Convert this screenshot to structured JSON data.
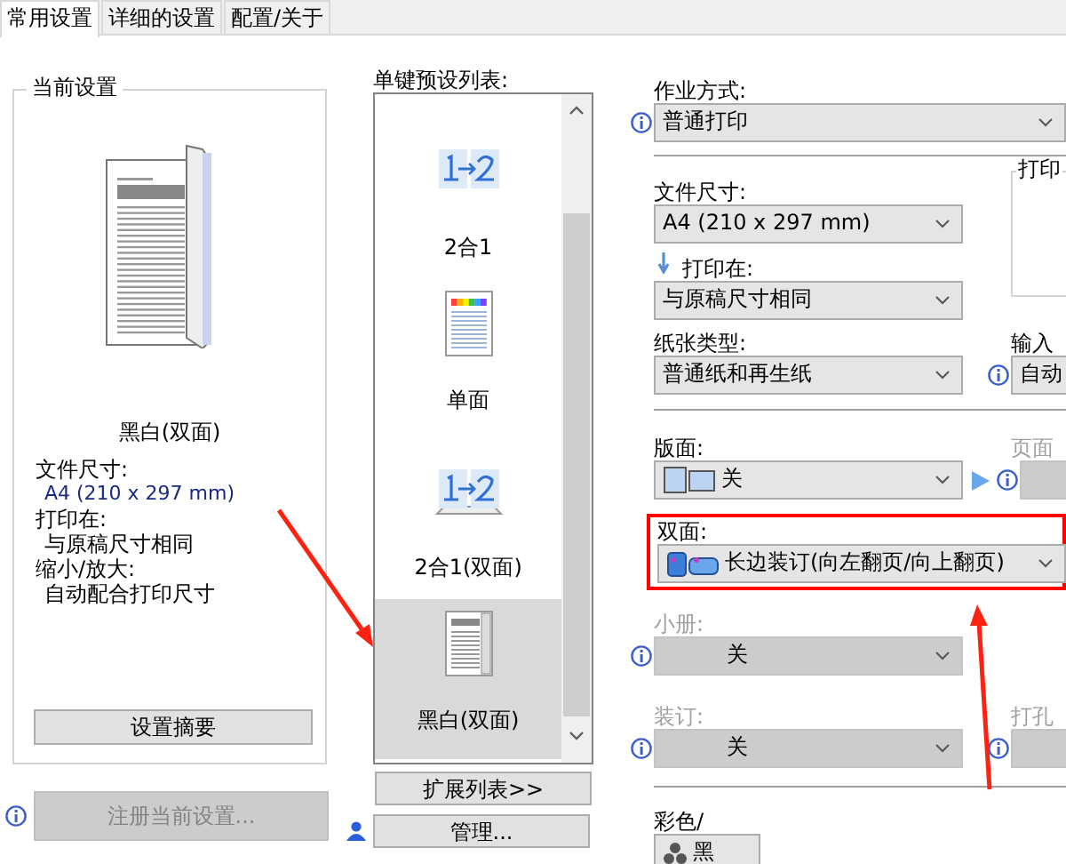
{
  "tabs": [
    {
      "label": "常用设置",
      "selected": true
    },
    {
      "label": "详细的设置",
      "selected": false
    },
    {
      "label": "配置/关于",
      "selected": false
    }
  ],
  "current_settings": {
    "title": "当前设置",
    "mode": "黑白(双面)",
    "details": [
      {
        "label": "文件尺寸:",
        "value": "A4 (210 x 297 mm)"
      },
      {
        "label": "打印在:",
        "value": "与原稿尺寸相同"
      },
      {
        "label": "缩小/放大:",
        "value": "自动配合打印尺寸"
      }
    ],
    "summary_button": "设置摘要"
  },
  "register_button": {
    "label": "注册当前设置...",
    "disabled": true
  },
  "presets": {
    "label": "单键预设列表:",
    "items": [
      {
        "label": "2合1",
        "kind": "nup",
        "selected": false
      },
      {
        "label": "单面",
        "kind": "color",
        "selected": false
      },
      {
        "label": "2合1(双面)",
        "kind": "nup-duplex",
        "selected": false
      },
      {
        "label": "黑白(双面)",
        "kind": "mono-duplex",
        "selected": true
      }
    ],
    "expand_button": "扩展列表>>",
    "manage_button": "管理..."
  },
  "job_mode": {
    "label": "作业方式:",
    "value": "普通打印",
    "disabled": false
  },
  "document_size": {
    "label": "文件尺寸:",
    "value": "A4 (210 x 297 mm)",
    "disabled": false
  },
  "print_on": {
    "label": "打印在:",
    "value": "与原稿尺寸相同",
    "disabled": false
  },
  "print_group": {
    "label": "打印"
  },
  "paper_type": {
    "label": "纸张类型:",
    "value": "普通纸和再生纸",
    "disabled": false
  },
  "input": {
    "label": "输入",
    "value": "自动",
    "disabled": false
  },
  "layout": {
    "label": "版面:",
    "value": "关",
    "disabled": false
  },
  "page": {
    "label": "页面",
    "disabled": true
  },
  "duplex": {
    "label": "双面:",
    "value": "长边装订(向左翻页/向上翻页)",
    "disabled": false,
    "highlighted": true
  },
  "booklet": {
    "label": "小册:",
    "value": "关",
    "disabled": true
  },
  "binding": {
    "label": "装订:",
    "value": "关",
    "disabled": true
  },
  "punch": {
    "label": "打孔",
    "disabled": true
  },
  "color_mode": {
    "label": "彩色/",
    "value": "黑",
    "disabled": false
  }
}
